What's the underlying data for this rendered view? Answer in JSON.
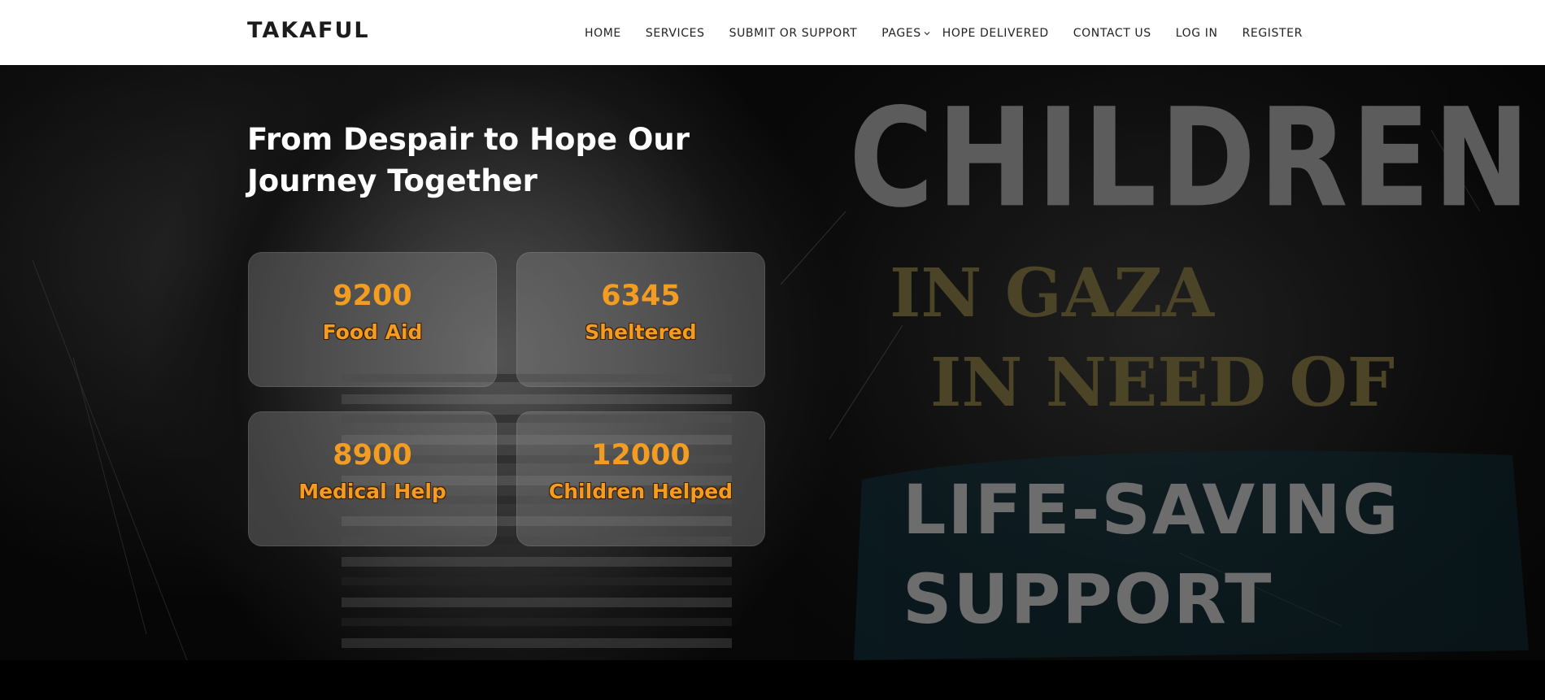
{
  "header": {
    "brand": "TAKAFUL",
    "nav": [
      {
        "label": "HOME"
      },
      {
        "label": "SERVICES"
      },
      {
        "label": "SUBMIT OR SUPPORT"
      },
      {
        "label": "PAGES",
        "has_dropdown": true
      },
      {
        "label": "HOPE DELIVERED"
      },
      {
        "label": "CONTACT US"
      },
      {
        "label": "LOG IN"
      },
      {
        "label": "REGISTER"
      }
    ]
  },
  "hero": {
    "title_line1": "From Despair to Hope Our",
    "title_line2": "Journey Together",
    "stats": [
      {
        "value": "9200",
        "label": "Food Aid"
      },
      {
        "value": "6345",
        "label": "Sheltered"
      },
      {
        "value": "8900",
        "label": "Medical Help"
      },
      {
        "value": "12000",
        "label": "Children Helped"
      }
    ],
    "poster": {
      "line1": "CHILDREN",
      "line2": "IN GAZA",
      "line3": "IN NEED OF",
      "line4": "LIFE-SAVING",
      "line5": "SUPPORT"
    }
  },
  "colors": {
    "accent": "#f39c22",
    "header_bg": "#ffffff",
    "hero_bg": "#080808",
    "card_bg": "rgba(135,135,135,0.40)"
  }
}
